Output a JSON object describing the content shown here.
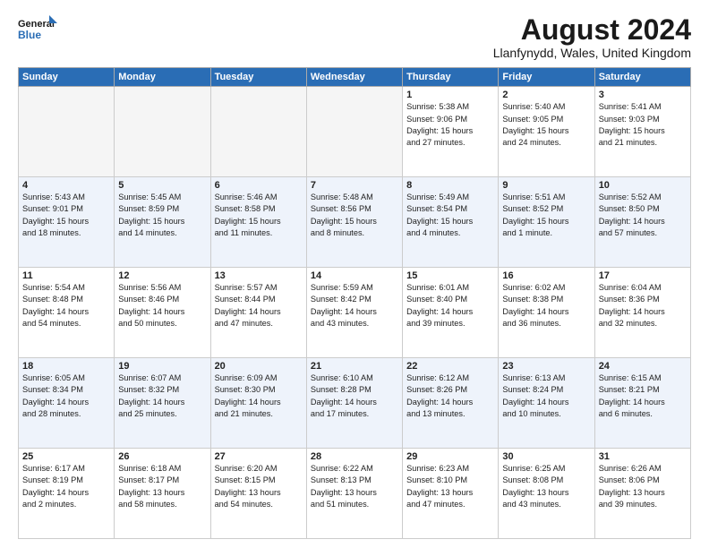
{
  "header": {
    "logo": {
      "line1": "General",
      "line2": "Blue"
    },
    "title": "August 2024",
    "subtitle": "Llanfynydd, Wales, United Kingdom"
  },
  "weekdays": [
    "Sunday",
    "Monday",
    "Tuesday",
    "Wednesday",
    "Thursday",
    "Friday",
    "Saturday"
  ],
  "weeks": [
    [
      {
        "day": "",
        "info": ""
      },
      {
        "day": "",
        "info": ""
      },
      {
        "day": "",
        "info": ""
      },
      {
        "day": "",
        "info": ""
      },
      {
        "day": "1",
        "info": "Sunrise: 5:38 AM\nSunset: 9:06 PM\nDaylight: 15 hours\nand 27 minutes."
      },
      {
        "day": "2",
        "info": "Sunrise: 5:40 AM\nSunset: 9:05 PM\nDaylight: 15 hours\nand 24 minutes."
      },
      {
        "day": "3",
        "info": "Sunrise: 5:41 AM\nSunset: 9:03 PM\nDaylight: 15 hours\nand 21 minutes."
      }
    ],
    [
      {
        "day": "4",
        "info": "Sunrise: 5:43 AM\nSunset: 9:01 PM\nDaylight: 15 hours\nand 18 minutes."
      },
      {
        "day": "5",
        "info": "Sunrise: 5:45 AM\nSunset: 8:59 PM\nDaylight: 15 hours\nand 14 minutes."
      },
      {
        "day": "6",
        "info": "Sunrise: 5:46 AM\nSunset: 8:58 PM\nDaylight: 15 hours\nand 11 minutes."
      },
      {
        "day": "7",
        "info": "Sunrise: 5:48 AM\nSunset: 8:56 PM\nDaylight: 15 hours\nand 8 minutes."
      },
      {
        "day": "8",
        "info": "Sunrise: 5:49 AM\nSunset: 8:54 PM\nDaylight: 15 hours\nand 4 minutes."
      },
      {
        "day": "9",
        "info": "Sunrise: 5:51 AM\nSunset: 8:52 PM\nDaylight: 15 hours\nand 1 minute."
      },
      {
        "day": "10",
        "info": "Sunrise: 5:52 AM\nSunset: 8:50 PM\nDaylight: 14 hours\nand 57 minutes."
      }
    ],
    [
      {
        "day": "11",
        "info": "Sunrise: 5:54 AM\nSunset: 8:48 PM\nDaylight: 14 hours\nand 54 minutes."
      },
      {
        "day": "12",
        "info": "Sunrise: 5:56 AM\nSunset: 8:46 PM\nDaylight: 14 hours\nand 50 minutes."
      },
      {
        "day": "13",
        "info": "Sunrise: 5:57 AM\nSunset: 8:44 PM\nDaylight: 14 hours\nand 47 minutes."
      },
      {
        "day": "14",
        "info": "Sunrise: 5:59 AM\nSunset: 8:42 PM\nDaylight: 14 hours\nand 43 minutes."
      },
      {
        "day": "15",
        "info": "Sunrise: 6:01 AM\nSunset: 8:40 PM\nDaylight: 14 hours\nand 39 minutes."
      },
      {
        "day": "16",
        "info": "Sunrise: 6:02 AM\nSunset: 8:38 PM\nDaylight: 14 hours\nand 36 minutes."
      },
      {
        "day": "17",
        "info": "Sunrise: 6:04 AM\nSunset: 8:36 PM\nDaylight: 14 hours\nand 32 minutes."
      }
    ],
    [
      {
        "day": "18",
        "info": "Sunrise: 6:05 AM\nSunset: 8:34 PM\nDaylight: 14 hours\nand 28 minutes."
      },
      {
        "day": "19",
        "info": "Sunrise: 6:07 AM\nSunset: 8:32 PM\nDaylight: 14 hours\nand 25 minutes."
      },
      {
        "day": "20",
        "info": "Sunrise: 6:09 AM\nSunset: 8:30 PM\nDaylight: 14 hours\nand 21 minutes."
      },
      {
        "day": "21",
        "info": "Sunrise: 6:10 AM\nSunset: 8:28 PM\nDaylight: 14 hours\nand 17 minutes."
      },
      {
        "day": "22",
        "info": "Sunrise: 6:12 AM\nSunset: 8:26 PM\nDaylight: 14 hours\nand 13 minutes."
      },
      {
        "day": "23",
        "info": "Sunrise: 6:13 AM\nSunset: 8:24 PM\nDaylight: 14 hours\nand 10 minutes."
      },
      {
        "day": "24",
        "info": "Sunrise: 6:15 AM\nSunset: 8:21 PM\nDaylight: 14 hours\nand 6 minutes."
      }
    ],
    [
      {
        "day": "25",
        "info": "Sunrise: 6:17 AM\nSunset: 8:19 PM\nDaylight: 14 hours\nand 2 minutes."
      },
      {
        "day": "26",
        "info": "Sunrise: 6:18 AM\nSunset: 8:17 PM\nDaylight: 13 hours\nand 58 minutes."
      },
      {
        "day": "27",
        "info": "Sunrise: 6:20 AM\nSunset: 8:15 PM\nDaylight: 13 hours\nand 54 minutes."
      },
      {
        "day": "28",
        "info": "Sunrise: 6:22 AM\nSunset: 8:13 PM\nDaylight: 13 hours\nand 51 minutes."
      },
      {
        "day": "29",
        "info": "Sunrise: 6:23 AM\nSunset: 8:10 PM\nDaylight: 13 hours\nand 47 minutes."
      },
      {
        "day": "30",
        "info": "Sunrise: 6:25 AM\nSunset: 8:08 PM\nDaylight: 13 hours\nand 43 minutes."
      },
      {
        "day": "31",
        "info": "Sunrise: 6:26 AM\nSunset: 8:06 PM\nDaylight: 13 hours\nand 39 minutes."
      }
    ]
  ]
}
